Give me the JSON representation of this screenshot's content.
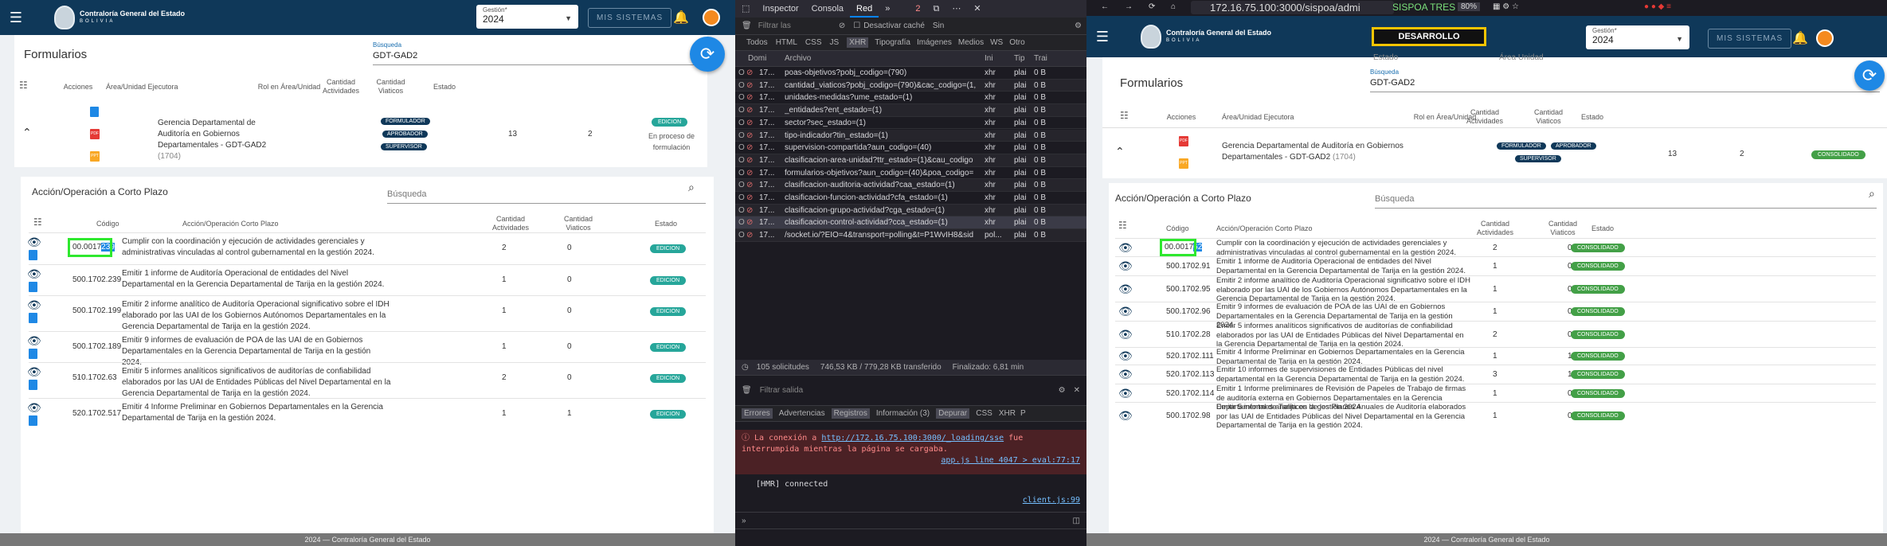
{
  "left": {
    "org_name": "Contraloría General del Estado",
    "org_sub": "BOLIVIA",
    "gestion_label": "Gestión*",
    "gestion_value": "2024",
    "mis_sistemas": "MIS SISTEMAS",
    "page_title": "Formularios",
    "search_label": "Búsqueda",
    "search_value": "GDT-GAD2",
    "headers": {
      "acciones": "Acciones",
      "area": "Área/Unidad Ejecutora",
      "rol": "Rol en Área/Unidad",
      "cant_act": "Cantidad Actividades",
      "cant_via": "Cantidad Viaticos",
      "estado": "Estado"
    },
    "form_row": {
      "area": "Gerencia Departamental de Auditoría en Gobiernos Departamentales - GDT-GAD2",
      "code": "(1704)",
      "roles": [
        "FORMULADOR",
        "APROBADOR",
        "SUPERVISOR"
      ],
      "actividades": "13",
      "viaticos": "2",
      "estado": "EDICION",
      "estado_note": "En proceso de formulación"
    },
    "sub_title": "Acción/Operación a Corto Plazo",
    "sub_search": "Búsqueda",
    "sub_headers": {
      "codigo": "Código",
      "accion": "Acción/Operación Corto Plazo",
      "cant_act": "Cantidad Actividades",
      "cant_via": "Cantidad Viaticos",
      "estado": "Estado"
    },
    "rows": [
      {
        "codigo": "00.0017",
        "codigo_sel": "239",
        "accion": "Cumplir con la coordinación y ejecución de actividades gerenciales y administrativas vinculadas al control gubernamental en la gestión 2024.",
        "act": "2",
        "via": "0",
        "estado": "EDICION"
      },
      {
        "codigo": "500.1702.239",
        "accion": "Emitir 1 informe de Auditoría Operacional de entidades del Nivel Departamental en la Gerencia Departamental de Tarija en la gestión 2024.",
        "act": "1",
        "via": "0",
        "estado": "EDICION"
      },
      {
        "codigo": "500.1702.199",
        "accion": "Emitir 2 informe analítico de Auditoría Operacional significativo sobre el IDH elaborado por las UAI de los Gobiernos Autónomos Departamentales en la Gerencia Departamental de Tarija en la gestión 2024.",
        "act": "1",
        "via": "0",
        "estado": "EDICION"
      },
      {
        "codigo": "500.1702.189",
        "accion": "Emitir 9 informes de evaluación de POA de las UAI de en Gobiernos Departamentales en la Gerencia Departamental de Tarija en la gestión 2024.",
        "act": "1",
        "via": "0",
        "estado": "EDICION"
      },
      {
        "codigo": "510.1702.63",
        "accion": "Emitir 5 informes analíticos significativos de auditorías de confiabilidad elaborados por las UAI de Entidades Públicas del Nivel Departamental en la Gerencia Departamental de Tarija en la gestión 2024.",
        "act": "2",
        "via": "0",
        "estado": "EDICION"
      },
      {
        "codigo": "520.1702.517",
        "accion": "Emitir 4 Informe Preliminar en Gobiernos Departamentales en la Gerencia Departamental de Tarija en la gestión 2024.",
        "act": "1",
        "via": "1",
        "estado": "EDICION"
      }
    ],
    "footer": "2024 — Contraloría General del Estado"
  },
  "dev": {
    "tabs": [
      "Inspector",
      "Consola",
      "Red"
    ],
    "badge": "2",
    "filter_placeholder": "Filtrar las",
    "cache_label": "Desactivar caché",
    "sin_label": "Sin",
    "types": [
      "Todos",
      "HTML",
      "CSS",
      "JS",
      "XHR",
      "Tipografía",
      "Imágenes",
      "Medios",
      "WS",
      "Otro"
    ],
    "cols": [
      "Domi",
      "Archivo",
      "Ini",
      "Tip",
      "Trai"
    ],
    "requests": [
      {
        "d": "17...",
        "f": "poas-objetivos?pobj_codigo=(790)",
        "i": "xhr",
        "t": "plai",
        "s": "0 B"
      },
      {
        "d": "17...",
        "f": "cantidad_viaticos?pobj_codigo=(790)&cac_codigo=(1,",
        "i": "xhr",
        "t": "plai",
        "s": "0 B"
      },
      {
        "d": "17...",
        "f": "unidades-medidas?ume_estado=(1)",
        "i": "xhr",
        "t": "plai",
        "s": "0 B"
      },
      {
        "d": "17...",
        "f": "_entidades?ent_estado=(1)",
        "i": "xhr",
        "t": "plai",
        "s": "0 B"
      },
      {
        "d": "17...",
        "f": "sector?sec_estado=(1)",
        "i": "xhr",
        "t": "plai",
        "s": "0 B"
      },
      {
        "d": "17...",
        "f": "tipo-indicador?tin_estado=(1)",
        "i": "xhr",
        "t": "plai",
        "s": "0 B"
      },
      {
        "d": "17...",
        "f": "supervision-compartida?aun_codigo=(40)",
        "i": "xhr",
        "t": "plai",
        "s": "0 B"
      },
      {
        "d": "17...",
        "f": "clasificacion-area-unidad?ttr_estado=(1)&cau_codigo",
        "i": "xhr",
        "t": "plai",
        "s": "0 B"
      },
      {
        "d": "17...",
        "f": "formularios-objetivos?aun_codigo=(40)&poa_codigo=",
        "i": "xhr",
        "t": "plai",
        "s": "0 B"
      },
      {
        "d": "17...",
        "f": "clasificacion-auditoria-actividad?caa_estado=(1)",
        "i": "xhr",
        "t": "plai",
        "s": "0 B"
      },
      {
        "d": "17...",
        "f": "clasificacion-funcion-actividad?cfa_estado=(1)",
        "i": "xhr",
        "t": "plai",
        "s": "0 B"
      },
      {
        "d": "17...",
        "f": "clasificacion-grupo-actividad?cga_estado=(1)",
        "i": "xhr",
        "t": "plai",
        "s": "0 B"
      },
      {
        "d": "17...",
        "f": "clasificacion-control-actividad?cca_estado=(1)",
        "i": "xhr",
        "t": "plai",
        "s": "0 B"
      },
      {
        "d": "17...",
        "f": "/socket.io/?EIO=4&transport=polling&t=P1WvIH8&sid",
        "i": "pol...",
        "t": "plai",
        "s": "0 B"
      }
    ],
    "summary": "105 solicitudes",
    "transfer": "746,53 KB / 779,28 KB transferido",
    "finish": "Finalizado: 6,81 min",
    "console_filter": "Filtrar salida",
    "console_tabs": [
      "Errores",
      "Advertencias",
      "Registros",
      "Información (3)",
      "Depurar",
      "CSS",
      "XHR",
      "P"
    ],
    "err_text1": "La conexión a",
    "err_link": "http://172.16.75.100:3000/_loading/sse",
    "err_text2": "fue interrumpida mientras la página se cargaba.",
    "err_src": "app.js line 4047 > eval:77:17",
    "hmr": "[HMR] connected",
    "hmr_src": "client.js:99"
  },
  "right": {
    "url": "172.16.75.100:3000/sispoa/admi",
    "url_badge": "SISPOA TRES",
    "zoom": "80%",
    "org_name": "Contraloría General del Estado",
    "org_sub": "BOLIVIA",
    "dev_label": "DESARROLLO",
    "gestion_label": "Gestión*",
    "gestion_value": "2024",
    "mis_sistemas": "MIS SISTEMAS",
    "top_fields": [
      "Estado",
      "Área Unidad"
    ],
    "page_title": "Formularios",
    "search_label": "Búsqueda",
    "search_value": "GDT-GAD2",
    "headers": {
      "acciones": "Acciones",
      "area": "Área/Unidad Ejecutora",
      "rol": "Rol en Área/Unidad",
      "cant_act": "Cantidad Actividades",
      "cant_via": "Cantidad Viaticos",
      "estado": "Estado"
    },
    "form_row": {
      "area": "Gerencia Departamental de Auditoría en Gobiernos Departamentales - GDT-GAD2",
      "code": "(1704)",
      "roles": [
        "FORMULADOR",
        "APROBADOR",
        "SUPERVISOR"
      ],
      "actividades": "13",
      "viaticos": "2",
      "estado": "CONSOLIDADO"
    },
    "sub_title": "Acción/Operación a Corto Plazo",
    "sub_search": "Búsqueda",
    "sub_headers": {
      "codigo": "Código",
      "accion": "Acción/Operación Corto Plazo",
      "cant_act": "Cantidad Actividades",
      "cant_via": "Cantidad Viaticos",
      "estado": "Estado"
    },
    "rows": [
      {
        "codigo": "00.0017",
        "codigo_sel": "62",
        "accion": "Cumplir con la coordinación y ejecución de actividades gerenciales y administrativas vinculadas al control gubernamental en la gestión 2024.",
        "act": "2",
        "via": "0",
        "estado": "CONSOLIDADO"
      },
      {
        "codigo": "500.1702.91",
        "accion": "Emitir 1 informe de Auditoría Operacional de entidades del Nivel Departamental en la Gerencia Departamental de Tarija en la gestión 2024.",
        "act": "1",
        "via": "0",
        "estado": "CONSOLIDADO"
      },
      {
        "codigo": "500.1702.95",
        "accion": "Emitir 2 informe analítico de Auditoría Operacional significativo sobre el IDH elaborado por las UAI de los Gobiernos Autónomos Departamentales en la Gerencia Departamental de Tarija en la gestión 2024.",
        "act": "1",
        "via": "0",
        "estado": "CONSOLIDADO"
      },
      {
        "codigo": "500.1702.96",
        "accion": "Emitir 9 informes de evaluación de POA de las UAI de en Gobiernos Departamentales en la Gerencia Departamental de Tarija en la gestión 2024.",
        "act": "1",
        "via": "0",
        "estado": "CONSOLIDADO"
      },
      {
        "codigo": "510.1702.28",
        "accion": "Emitir 5 informes analíticos significativos de auditorías de confiabilidad elaborados por las UAI de Entidades Públicas del Nivel Departamental en la Gerencia Departamental de Tarija en la gestión 2024.",
        "act": "2",
        "via": "0",
        "estado": "CONSOLIDADO"
      },
      {
        "codigo": "520.1702.111",
        "accion": "Emitir 4 Informe Preliminar en Gobiernos Departamentales en la Gerencia Departamental de Tarija en la gestión 2024.",
        "act": "1",
        "via": "1",
        "estado": "CONSOLIDADO"
      },
      {
        "codigo": "520.1702.113",
        "accion": "Emitir 10 informes de supervisiones de Entidades Públicas del nivel departamental en la Gerencia Departamental de Tarija en la gestión 2024.",
        "act": "3",
        "via": "1",
        "estado": "CONSOLIDADO"
      },
      {
        "codigo": "520.1702.114",
        "accion": "Emitir 1 Informe preliminares de Revisión de Papeles de Trabajo de firmas de auditoría externa en Gobiernos Departamentales en la Gerencia Departamental de Tarija en la gestión 2024",
        "act": "1",
        "via": "0",
        "estado": "CONSOLIDADO"
      },
      {
        "codigo": "500.1702.98",
        "accion": "Emitir 5 informes analíticos de los Planes Anuales de Auditoría elaborados por las UAI de Entidades Públicas del Nivel Departamental en la Gerencia Departamental de Tarija en la gestión 2024.",
        "act": "1",
        "via": "0",
        "estado": "CONSOLIDADO"
      }
    ],
    "footer": "2024 — Contraloría General del Estado"
  },
  "colors": {
    "navy": "#0f3859",
    "teal": "#26a69a",
    "green": "#43a047",
    "highlight": "#2ee82e",
    "blue": "#1e88e5"
  }
}
